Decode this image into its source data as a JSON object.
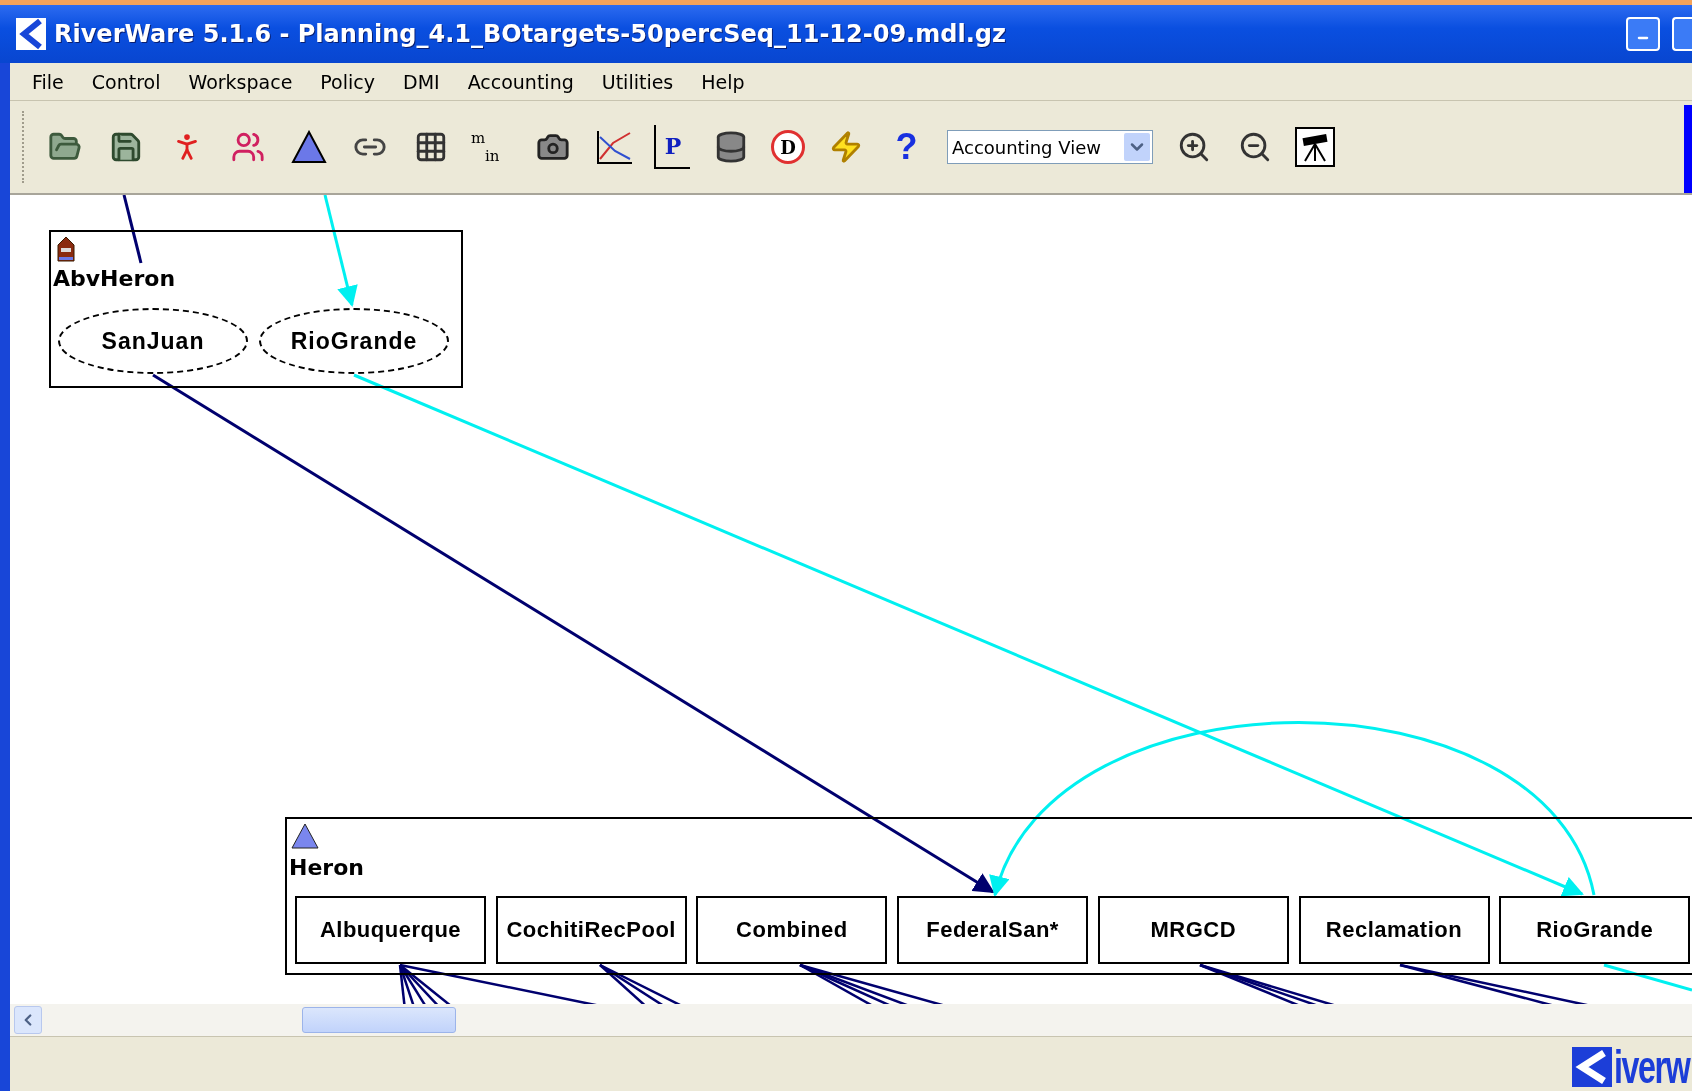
{
  "window": {
    "title": "RiverWare 5.1.6 - Planning_4.1_BOtargets-50percSeq_11-12-09.mdl.gz"
  },
  "menu": [
    "File",
    "Control",
    "Workspace",
    "Policy",
    "DMI",
    "Accounting",
    "Utilities",
    "Help"
  ],
  "toolbar": [
    {
      "kind": "open"
    },
    {
      "kind": "save"
    },
    {
      "kind": "run"
    },
    {
      "kind": "run-multi"
    },
    {
      "kind": "triangle"
    },
    {
      "kind": "link"
    },
    {
      "kind": "grid"
    },
    {
      "kind": "m-in",
      "top": "m",
      "bottom": "in"
    },
    {
      "kind": "camera"
    },
    {
      "kind": "chart"
    },
    {
      "kind": "plot",
      "label": "P"
    },
    {
      "kind": "database"
    },
    {
      "kind": "stop",
      "label": "D"
    },
    {
      "kind": "lightning"
    },
    {
      "kind": "help",
      "label": "?"
    },
    {
      "kind": "dropdown",
      "value": "Accounting View"
    },
    {
      "kind": "zoom-in"
    },
    {
      "kind": "zoom-out"
    },
    {
      "kind": "telescope"
    }
  ],
  "canvas": {
    "groups": [
      {
        "name": "AbvHeron",
        "kind": "house",
        "nodes": [
          "SanJuan",
          "RioGrande"
        ]
      },
      {
        "name": "Heron",
        "kind": "triangle",
        "nodes": [
          "Albuquerque",
          "CochitiRecPool",
          "Combined",
          "FederalSan*",
          "MRGCD",
          "Reclamation",
          "RioGrande"
        ]
      }
    ]
  },
  "status_bar": {
    "logo": "iverw"
  }
}
